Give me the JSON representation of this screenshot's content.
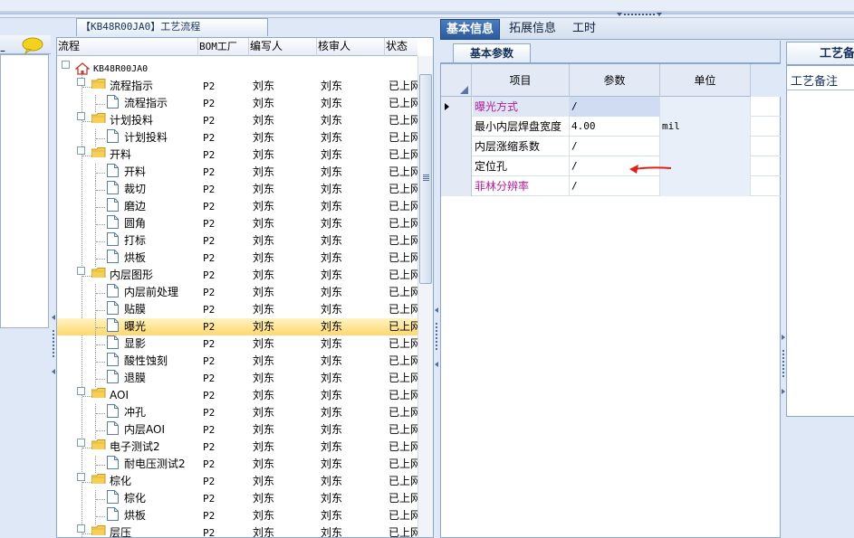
{
  "tree_panel": {
    "tab_title": "【KB48R00JA0】工艺流程",
    "columns": [
      "流程",
      "BOM工厂",
      "编写人",
      "核审人",
      "状态"
    ],
    "root": "KB48R00JA0",
    "rows": [
      {
        "label": "流程指示",
        "level": 1,
        "kind": "folder",
        "bom": "P2",
        "writer": "刘东",
        "reviewer": "刘东",
        "status": "已上网"
      },
      {
        "label": "流程指示",
        "level": 2,
        "kind": "doc",
        "bom": "P2",
        "writer": "刘东",
        "reviewer": "刘东",
        "status": "已上网"
      },
      {
        "label": "计划投料",
        "level": 1,
        "kind": "folder",
        "bom": "P2",
        "writer": "刘东",
        "reviewer": "刘东",
        "status": "已上网"
      },
      {
        "label": "计划投料",
        "level": 2,
        "kind": "doc",
        "bom": "P2",
        "writer": "刘东",
        "reviewer": "刘东",
        "status": "已上网"
      },
      {
        "label": "开料",
        "level": 1,
        "kind": "folder",
        "bom": "P2",
        "writer": "刘东",
        "reviewer": "刘东",
        "status": "已上网"
      },
      {
        "label": "开料",
        "level": 2,
        "kind": "doc",
        "bom": "P2",
        "writer": "刘东",
        "reviewer": "刘东",
        "status": "已上网"
      },
      {
        "label": "裁切",
        "level": 2,
        "kind": "doc",
        "bom": "P2",
        "writer": "刘东",
        "reviewer": "刘东",
        "status": "已上网"
      },
      {
        "label": "磨边",
        "level": 2,
        "kind": "doc",
        "bom": "P2",
        "writer": "刘东",
        "reviewer": "刘东",
        "status": "已上网"
      },
      {
        "label": "圆角",
        "level": 2,
        "kind": "doc",
        "bom": "P2",
        "writer": "刘东",
        "reviewer": "刘东",
        "status": "已上网"
      },
      {
        "label": "打标",
        "level": 2,
        "kind": "doc",
        "bom": "P2",
        "writer": "刘东",
        "reviewer": "刘东",
        "status": "已上网"
      },
      {
        "label": "烘板",
        "level": 2,
        "kind": "doc",
        "bom": "P2",
        "writer": "刘东",
        "reviewer": "刘东",
        "status": "已上网"
      },
      {
        "label": "内层图形",
        "level": 1,
        "kind": "folder",
        "bom": "P2",
        "writer": "刘东",
        "reviewer": "刘东",
        "status": "已上网"
      },
      {
        "label": "内层前处理",
        "level": 2,
        "kind": "doc",
        "bom": "P2",
        "writer": "刘东",
        "reviewer": "刘东",
        "status": "已上网"
      },
      {
        "label": "贴膜",
        "level": 2,
        "kind": "doc",
        "bom": "P2",
        "writer": "刘东",
        "reviewer": "刘东",
        "status": "已上网"
      },
      {
        "label": "曝光",
        "level": 2,
        "kind": "doc",
        "bom": "P2",
        "writer": "刘东",
        "reviewer": "刘东",
        "status": "已上网",
        "selected": true
      },
      {
        "label": "显影",
        "level": 2,
        "kind": "doc",
        "bom": "P2",
        "writer": "刘东",
        "reviewer": "刘东",
        "status": "已上网"
      },
      {
        "label": "酸性蚀刻",
        "level": 2,
        "kind": "doc",
        "bom": "P2",
        "writer": "刘东",
        "reviewer": "刘东",
        "status": "已上网"
      },
      {
        "label": "退膜",
        "level": 2,
        "kind": "doc",
        "bom": "P2",
        "writer": "刘东",
        "reviewer": "刘东",
        "status": "已上网"
      },
      {
        "label": "AOI",
        "level": 1,
        "kind": "folder",
        "bom": "P2",
        "writer": "刘东",
        "reviewer": "刘东",
        "status": "已上网"
      },
      {
        "label": "冲孔",
        "level": 2,
        "kind": "doc",
        "bom": "P2",
        "writer": "刘东",
        "reviewer": "刘东",
        "status": "已上网"
      },
      {
        "label": "内层AOI",
        "level": 2,
        "kind": "doc",
        "bom": "P2",
        "writer": "刘东",
        "reviewer": "刘东",
        "status": "已上网"
      },
      {
        "label": "电子测试2",
        "level": 1,
        "kind": "folder",
        "bom": "P2",
        "writer": "刘东",
        "reviewer": "刘东",
        "status": "已上网"
      },
      {
        "label": "耐电压测试2",
        "level": 2,
        "kind": "doc",
        "bom": "P2",
        "writer": "刘东",
        "reviewer": "刘东",
        "status": "已上网"
      },
      {
        "label": "棕化",
        "level": 1,
        "kind": "folder",
        "bom": "P2",
        "writer": "刘东",
        "reviewer": "刘东",
        "status": "已上网"
      },
      {
        "label": "棕化",
        "level": 2,
        "kind": "doc",
        "bom": "P2",
        "writer": "刘东",
        "reviewer": "刘东",
        "status": "已上网"
      },
      {
        "label": "烘板",
        "level": 2,
        "kind": "doc",
        "bom": "P2",
        "writer": "刘东",
        "reviewer": "刘东",
        "status": "已上网"
      },
      {
        "label": "层压",
        "level": 1,
        "kind": "folder",
        "bom": "P2",
        "writer": "刘东",
        "reviewer": "刘东",
        "status": "已上网"
      }
    ]
  },
  "tabs": {
    "basic": "基本信息",
    "extended": "拓展信息",
    "hours": "工时"
  },
  "basic_params": {
    "subtab": "基本参数",
    "headers": {
      "item": "项目",
      "param": "参数",
      "unit": "单位"
    },
    "rows": [
      {
        "item": "曝光方式",
        "param": "/",
        "unit": "",
        "pink": true,
        "focus": true
      },
      {
        "item": "最小内层焊盘宽度",
        "param": "4.00",
        "unit": "mil",
        "pink": false
      },
      {
        "item": "内层涨缩系数",
        "param": "/",
        "unit": "",
        "pink": false
      },
      {
        "item": "定位孔",
        "param": "/",
        "unit": "",
        "pink": false
      },
      {
        "item": "菲林分辨率",
        "param": "/",
        "unit": "",
        "pink": true
      }
    ]
  },
  "remarks_panel": {
    "tab": "工艺备",
    "label": "工艺备注"
  },
  "colors": {
    "accent_tab": "#2b5b9d",
    "pink_text": "#b01c9c",
    "selection": "#ffd86e",
    "arrow": "#e0201c"
  }
}
